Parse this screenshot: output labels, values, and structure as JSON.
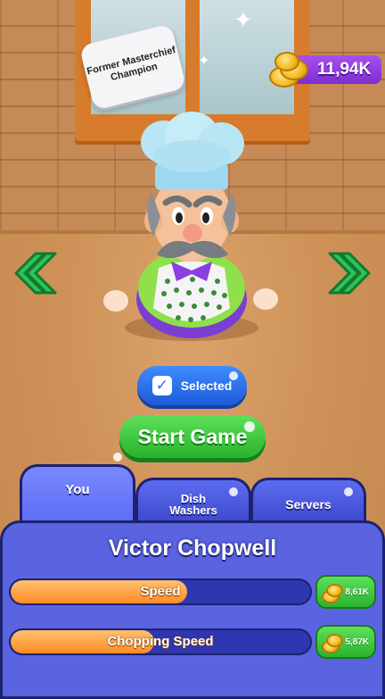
{
  "title_badge": "Former Masterchief Champion",
  "currency": {
    "amount": "11,94K",
    "icon": "gold-coins-icon"
  },
  "navigation": {
    "prev_icon": "double-chevron-left-icon",
    "next_icon": "double-chevron-right-icon"
  },
  "selection": {
    "label": "Selected",
    "checked": true
  },
  "start_button": {
    "label": "Start Game"
  },
  "tabs": [
    {
      "label": "You",
      "active": true
    },
    {
      "label": "Dish Washers",
      "active": false
    },
    {
      "label": "Servers",
      "active": false
    }
  ],
  "character": {
    "name": "Victor Chopwell"
  },
  "stats": [
    {
      "label": "Speed",
      "progress": 0.59,
      "upgrade_cost": "8,61K"
    },
    {
      "label": "Chopping Speed",
      "progress": 0.48,
      "upgrade_cost": "5,87K"
    }
  ],
  "colors": {
    "accent_green": "#2ab32f",
    "accent_blue": "#5a63e0",
    "coin_bar": "#8a3be0",
    "stat_fill": "#ff8a22"
  }
}
